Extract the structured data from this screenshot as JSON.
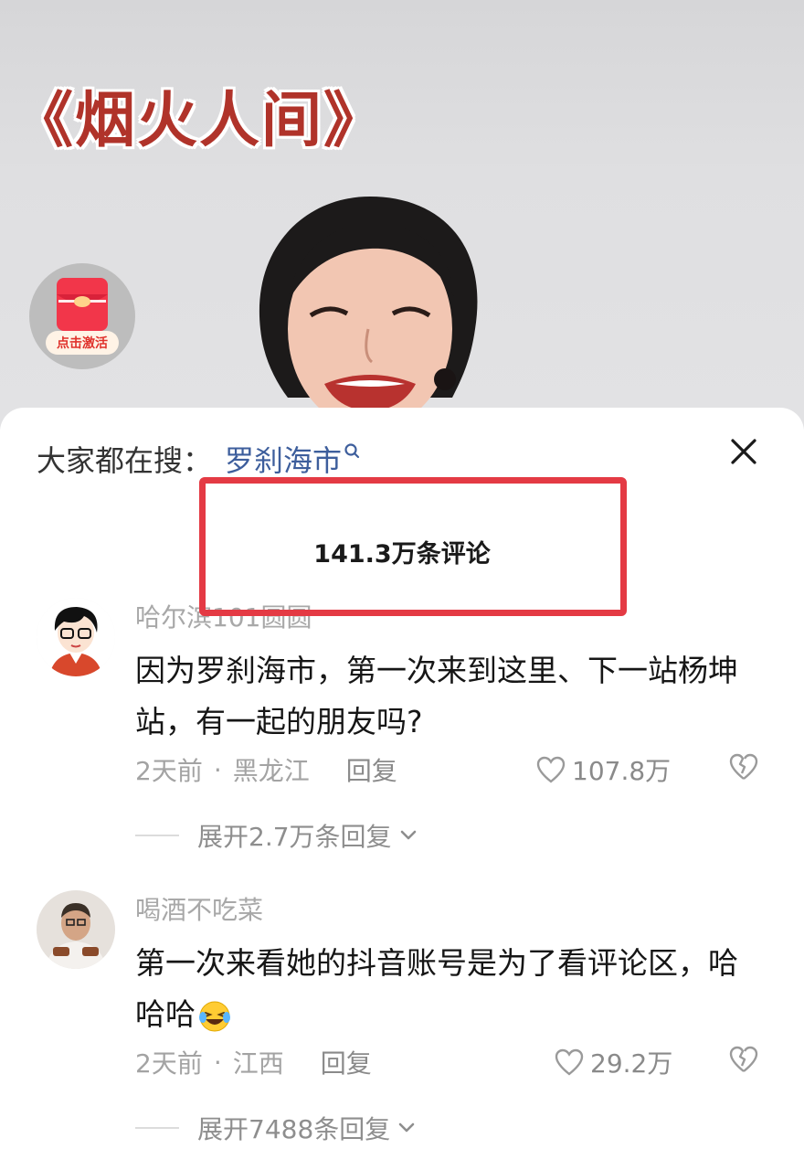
{
  "video": {
    "title": "《烟火人间》",
    "activate_badge": {
      "label": "点击激活",
      "icon": "red-envelope-icon"
    }
  },
  "sheet": {
    "search": {
      "prefix": "大家都在搜：",
      "term": "罗刹海市",
      "icon": "search-icon"
    },
    "close_icon": "close-icon",
    "comment_count": "141.3万条评论",
    "highlight_color": "#e43a44",
    "comments": [
      {
        "username": "哈尔滨101圆圆",
        "text": "因为罗刹海市，第一次来到这里、下一站杨坤站，有一起的朋友吗?",
        "time": "2天前",
        "separator": "·",
        "location": "黑龙江",
        "reply_label": "回复",
        "likes": "107.8万",
        "expand_label": "展开2.7万条回复"
      },
      {
        "username": "喝酒不吃菜",
        "text": "第一次来看她的抖音账号是为了看评论区，哈哈哈",
        "emoji": "laughing-tears-emoji",
        "time": "2天前",
        "separator": "·",
        "location": "江西",
        "reply_label": "回复",
        "likes": "29.2万",
        "expand_label": "展开7488条回复"
      }
    ]
  }
}
